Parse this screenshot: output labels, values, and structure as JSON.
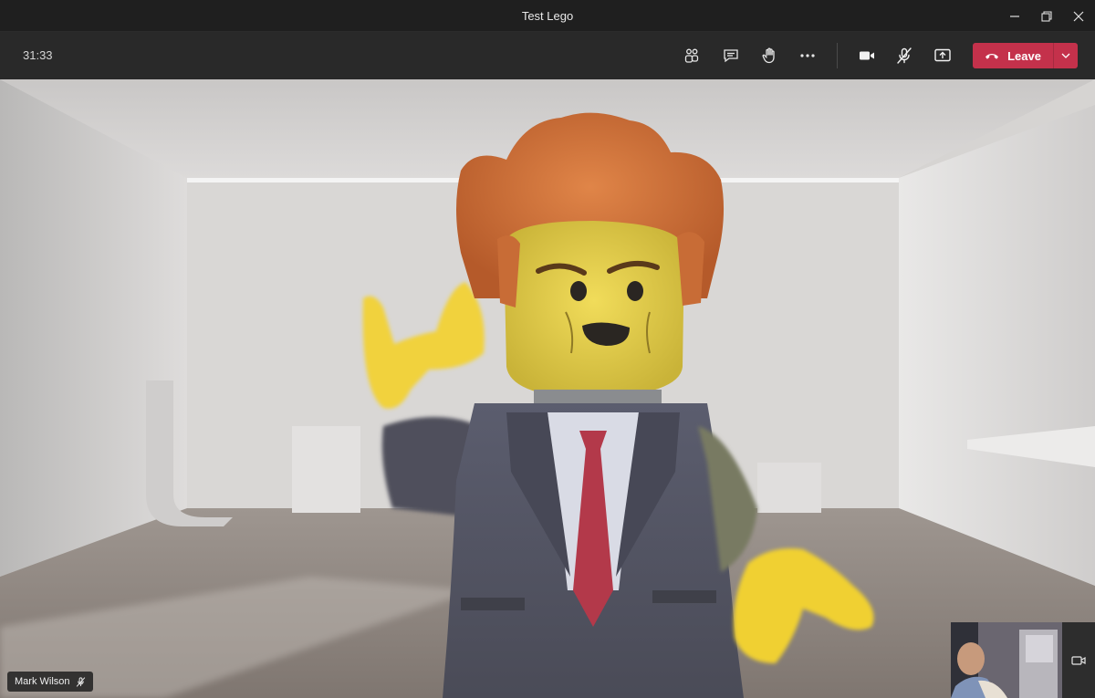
{
  "window": {
    "title": "Test Lego",
    "controls": [
      "minimize-icon",
      "restore-icon",
      "close-icon"
    ]
  },
  "toolbar": {
    "timer": "31:33",
    "buttons": [
      "participants-icon",
      "chat-icon",
      "raise-hand-icon",
      "more-options-icon",
      "camera-icon",
      "mic-off-icon",
      "share-screen-icon"
    ],
    "leave_label": "Leave"
  },
  "stage": {
    "participant_name": "Mark Wilson",
    "participant_muted": true
  },
  "colors": {
    "leave": "#c4314b",
    "titlebar": "#1f1f1f",
    "toolbar": "#292929"
  }
}
